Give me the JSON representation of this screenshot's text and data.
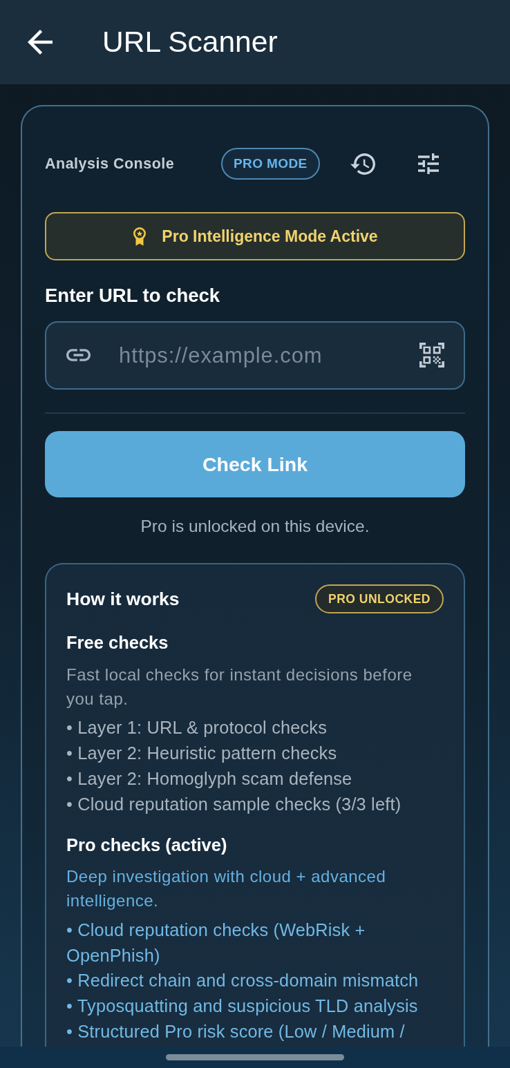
{
  "app_bar": {
    "title": "URL Scanner"
  },
  "console": {
    "title": "Analysis Console",
    "mode_badge": "PRO MODE"
  },
  "banner": {
    "text": "Pro Intelligence Mode Active"
  },
  "url_input": {
    "label": "Enter URL to check",
    "placeholder": "https://example.com"
  },
  "check_button": {
    "label": "Check Link"
  },
  "status_note": "Pro is unlocked on this device.",
  "how_it_works": {
    "title": "How it works",
    "badge": "PRO UNLOCKED",
    "sections": [
      {
        "kind": "free",
        "title": "Free checks",
        "description": "Fast local checks for instant decisions before you tap.",
        "items": [
          "• Layer 1: URL & protocol checks",
          "• Layer 2: Heuristic pattern checks",
          "• Layer 2: Homoglyph scam defense",
          "• Cloud reputation sample checks (3/3 left)"
        ]
      },
      {
        "kind": "pro",
        "title": "Pro checks (active)",
        "description": "Deep investigation with cloud + advanced intelligence.",
        "items": [
          "• Cloud reputation checks (WebRisk + OpenPhish)",
          "• Redirect chain and cross-domain mismatch",
          "• Typosquatting and suspicious TLD analysis",
          "• Structured Pro risk score (Low / Medium /"
        ]
      }
    ]
  }
}
